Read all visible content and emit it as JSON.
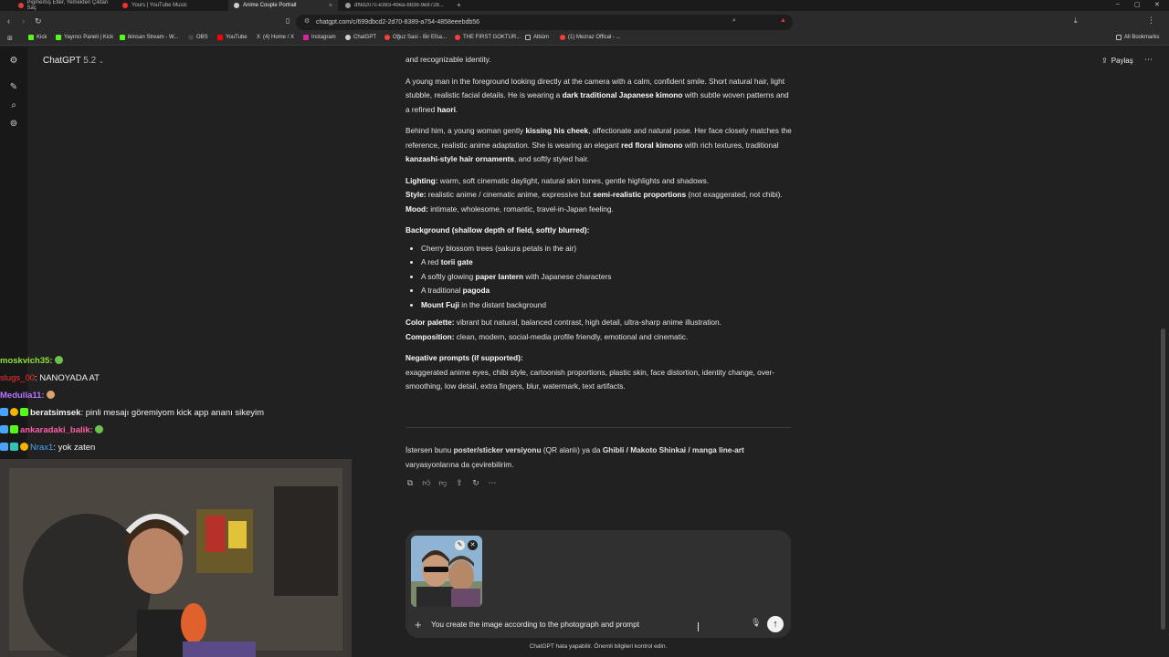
{
  "browser": {
    "tabs": [
      {
        "title": "Pigmemiş Etler, Yemekten Çıktan Saç",
        "active": false
      },
      {
        "title": "Yours | YouTube Music",
        "active": false
      },
      {
        "title": "Anime Couple Portrait",
        "active": true
      },
      {
        "title": "df9d207c-e383-49ea-8838-9e8728...",
        "active": false
      }
    ],
    "new_tab": "+",
    "window_controls": [
      "–",
      "▢",
      "✕"
    ],
    "url": "chatgpt.com/c/699dbcd2-2d70-8389-a754-4858eeebdb56",
    "bookmarks": [
      "Kick",
      "Yayıncı Paneli | Kick",
      "ikinsan Stream - W...",
      "OBS",
      "YouTube",
      "(4) Home / X",
      "Instagram",
      "ChatGPT",
      "Oğuz Sasi - Bir Efsa...",
      "THE FIRST GOKTUR...",
      "Albüm",
      "(1) Mezraz Offical - ..."
    ],
    "all_bookmarks": "All Bookmarks"
  },
  "app": {
    "model_name": "ChatGPT",
    "model_version": "5.2",
    "share_label": "Paylaş"
  },
  "response": {
    "line0": "and recognizable identity.",
    "p1_pre": "A young man in the foreground looking directly at the camera with a calm, confident smile. Short natural hair, light stubble, realistic facial details. He is wearing a ",
    "p1_b1": "dark traditional Japanese kimono",
    "p1_mid": " with subtle woven patterns and a refined ",
    "p1_b2": "haori",
    "p1_end": ".",
    "p2_pre": "Behind him, a young woman gently ",
    "p2_b1": "kissing his cheek",
    "p2_mid": ", affectionate and natural pose. Her face closely matches the reference, realistic anime adaptation. She is wearing an elegant ",
    "p2_b2": "red floral kimono",
    "p2_mid2": " with rich textures, traditional ",
    "p2_b3": "kanzashi-style hair ornaments",
    "p2_end": ", and softly styled hair.",
    "lighting_label": "Lighting:",
    "lighting_text": " warm, soft cinematic daylight, natural skin tones, gentle highlights and shadows.",
    "style_label": "Style:",
    "style_pre": " realistic anime / cinematic anime, expressive but ",
    "style_b": "semi-realistic proportions",
    "style_end": " (not exaggerated, not chibi).",
    "mood_label": "Mood:",
    "mood_text": " intimate, wholesome, romantic, travel-in-Japan feeling.",
    "bg_heading": "Background (shallow depth of field, softly blurred):",
    "bg_items": [
      {
        "pre": "Cherry blossom trees (sakura petals in the air)",
        "b": "",
        "post": ""
      },
      {
        "pre": "A red ",
        "b": "torii gate",
        "post": ""
      },
      {
        "pre": "A softly glowing ",
        "b": "paper lantern",
        "post": " with Japanese characters"
      },
      {
        "pre": "A traditional ",
        "b": "pagoda",
        "post": ""
      },
      {
        "pre": "",
        "b": "Mount Fuji",
        "post": " in the distant background"
      }
    ],
    "palette_label": "Color palette:",
    "palette_text": " vibrant but natural, balanced contrast, high detail, ultra-sharp anime illustration.",
    "composition_label": "Composition:",
    "composition_text": " clean, modern, social-media profile friendly, emotional and cinematic.",
    "neg_heading": "Negative prompts (if supported):",
    "neg_text": "exaggerated anime eyes, chibi style, cartoonish proportions, plastic skin, face distortion, identity change, over-smoothing, low detail, extra fingers, blur, watermark, text artifacts.",
    "followup_pre": "İstersen bunu ",
    "followup_b1": "poster/sticker versiyonu",
    "followup_mid": " (QR alanlı) ya da ",
    "followup_b2": "Ghibli / Makoto Shinkai / manga line-art",
    "followup_end": " varyasyonlarına da çevirebilirim."
  },
  "composer": {
    "prompt_text": "You create the image according to the photograph and prompt",
    "disclaimer": "ChatGPT hata yapabilir. Önemli bilgileri kontrol edin."
  },
  "stream_chat": [
    {
      "user": "moskvich35:",
      "text": "",
      "user_color": "#8ae234",
      "emote": true
    },
    {
      "user": "slugs_00",
      "text": ": NANOYADA AT",
      "user_color": "#ff2d2d",
      "emote": false
    },
    {
      "user": "Medulla11:",
      "text": "",
      "user_color": "#b478ff",
      "emote": true
    },
    {
      "user": "beratsimsek",
      "text": ": pinli mesajı göremiyom kick app ananı sikeyim",
      "user_color": "#ffffff",
      "emote": false
    },
    {
      "user": "ankaradaki_balik:",
      "text": "",
      "user_color": "#ff5fa8",
      "emote": true
    },
    {
      "user": "Nrax1",
      "text": ": yok zaten",
      "user_color": "#4aa3ff",
      "emote": false
    }
  ],
  "colors": {
    "app_bg": "#212121",
    "composer_bg": "#303030",
    "send_button": "#f2f2f2"
  }
}
